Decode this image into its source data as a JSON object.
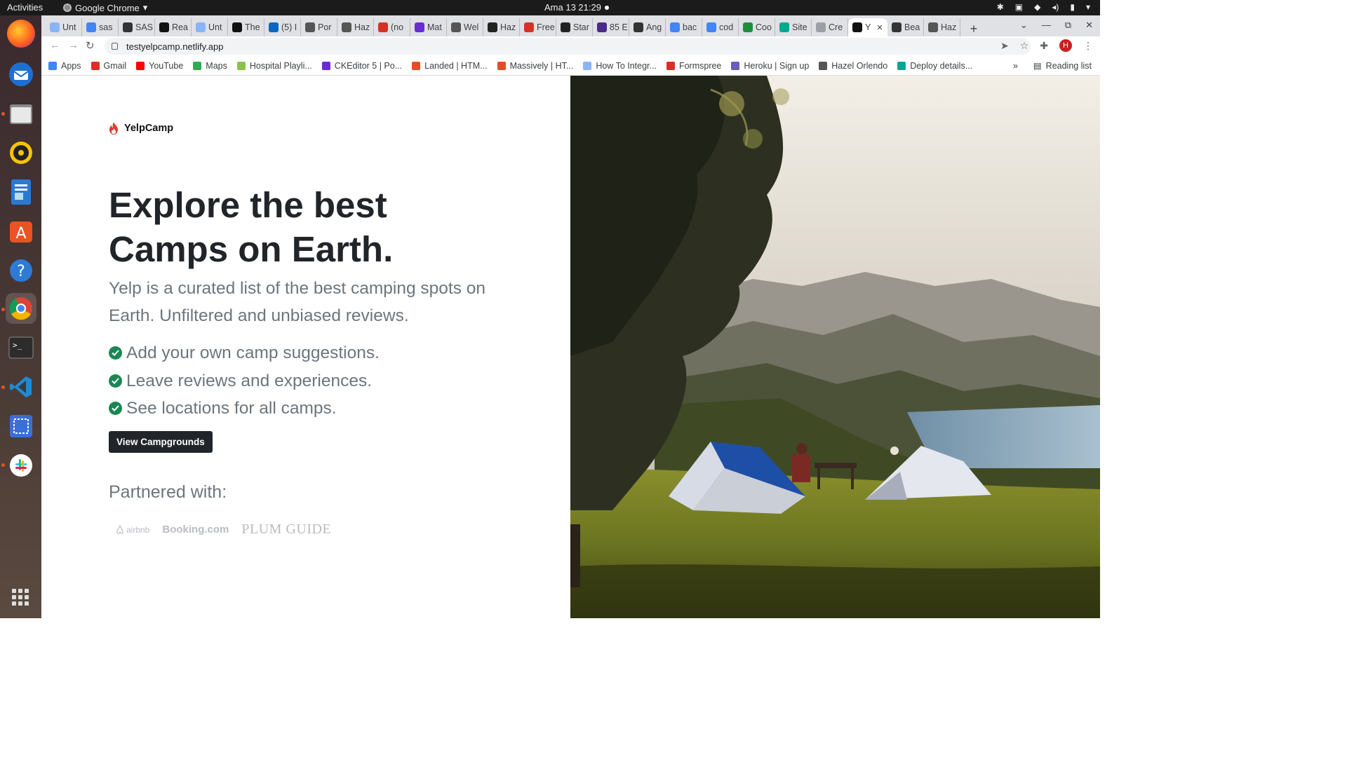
{
  "system": {
    "activities": "Activities",
    "app_name": "Google Chrome",
    "clock": "Ama 13  21:29"
  },
  "browser": {
    "tabs": [
      "Unt",
      "sas",
      "SAS",
      "Rea",
      "Unt",
      "The",
      "(5) I",
      "Por",
      "Haz",
      "(no",
      "Mat",
      "Wel",
      "Haz",
      "Free",
      "Star",
      "85 E",
      "Ang",
      "bac",
      "cod",
      "Coo",
      "Site",
      "Cre",
      "Y",
      "Bea",
      "Haz"
    ],
    "active_tab_index": 22,
    "url": "testyelpcamp.netlify.app",
    "avatar_letter": "H",
    "bookmarks": [
      "Apps",
      "Gmail",
      "YouTube",
      "Maps",
      "Hospital Playli...",
      "CKEditor 5 | Po...",
      "Landed | HTM...",
      "Massively | HT...",
      "How To Integr...",
      "Formspree",
      "Heroku | Sign up",
      "Hazel Orlendo",
      "Deploy details..."
    ],
    "bookmarks_overflow": "»",
    "reading_list": "Reading list"
  },
  "page": {
    "brand": "YelpCamp",
    "headline": "Explore the best Camps on Earth.",
    "subtitle": "Yelp is a curated list of the best camping spots on Earth. Unfiltered and unbiased reviews.",
    "features": [
      "Add your own camp suggestions.",
      "Leave reviews and experiences.",
      "See locations for all camps."
    ],
    "cta_label": "View Campgrounds",
    "partnered_label": "Partnered with:",
    "partners": [
      "airbnb",
      "Booking.com",
      "PLUM GUIDE"
    ]
  },
  "colors": {
    "accent_dark": "#212529",
    "muted_text": "#6c757d",
    "check_green": "#198754",
    "flame_red": "#e03a2f"
  }
}
